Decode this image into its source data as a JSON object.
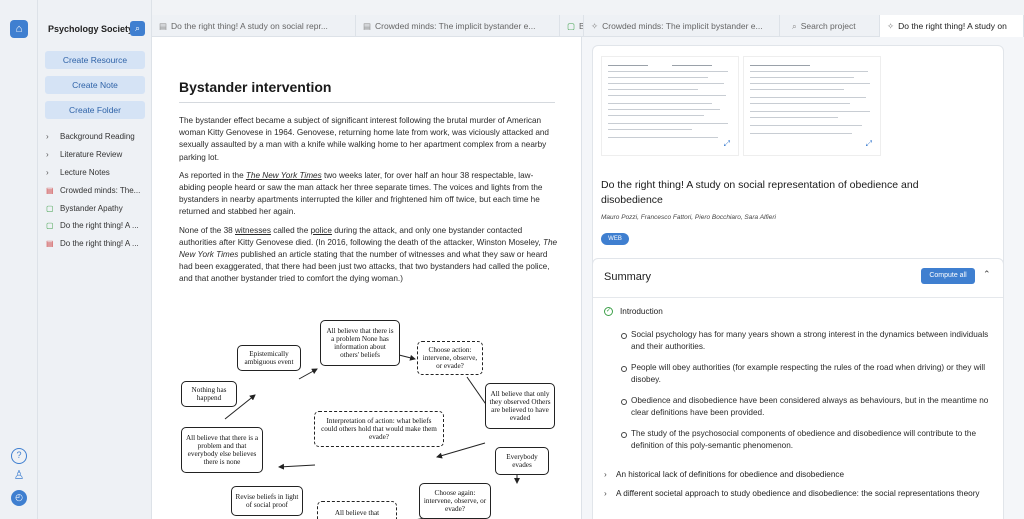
{
  "sidebar": {
    "title": "Psychology Society",
    "buttons": [
      "Create Resource",
      "Create Note",
      "Create Folder"
    ],
    "tree": [
      {
        "label": "Background Reading",
        "kind": "folder"
      },
      {
        "label": "Literature Review",
        "kind": "folder"
      },
      {
        "label": "Lecture Notes",
        "kind": "folder"
      },
      {
        "label": "Crowded minds: The...",
        "kind": "pdf"
      },
      {
        "label": "Bystander Apathy",
        "kind": "note"
      },
      {
        "label": "Do the right thing! A ...",
        "kind": "note"
      },
      {
        "label": "Do the right thing! A ...",
        "kind": "pdf"
      }
    ]
  },
  "tabs": [
    {
      "label": "Do the right thing! A study on social repr...",
      "icon": "pdf-icon"
    },
    {
      "label": "Crowded minds: The implicit bystander e...",
      "icon": "page-icon"
    },
    {
      "label": "B",
      "icon": "note-icon"
    },
    {
      "label": "Crowded minds: The implicit bystander e...",
      "icon": "sparkle-icon"
    },
    {
      "label": "Search project",
      "icon": "search-icon"
    },
    {
      "label": "Do the right thing! A study on",
      "icon": "sparkle-icon"
    }
  ],
  "document": {
    "title": "Bystander intervention",
    "p1": "The bystander effect became a subject of significant interest following the brutal murder of American woman Kitty Genovese in 1964. Genovese, returning home late from work, was viciously attacked and sexually assaulted by a man with a knife while walking home to her apartment complex from a nearby parking lot.",
    "p2_a": "As reported in the ",
    "p2_link": "The New York Times",
    "p2_b": " two weeks later, for over half an hour 38 respectable, law-abiding people heard or saw the man attack her three separate times. The voices and lights from the bystanders in nearby apartments interrupted the killer and frightened him off twice, but each time he returned and stabbed her again.",
    "p3_a": "None of the 38 ",
    "p3_link1": "witnesses",
    "p3_b": " called the ",
    "p3_link2": "police",
    "p3_c": " during the attack, and only one bystander contacted authorities after Kitty Genovese died. (In 2016, following the death of the attacker, Winston Moseley, ",
    "p3_ital": "The New York Times",
    "p3_d": " published an article stating that the number of witnesses and what they saw or heard had been exaggerated, that there had been just two attacks, that two bystanders had called the police, and that another bystander tried to comfort the dying woman.)",
    "diagram": {
      "n_believe_problem": "All believe that there is a problem None has information about others' beliefs",
      "n_ambiguous": "Epistemically ambiguous event",
      "n_choose": "Choose action: intervene, observe, or evade?",
      "n_nothing": "Nothing has happend",
      "n_observed": "All believe that only they observed Others are believed to have evaded",
      "n_interpret": "Interpretation of action: what beliefs could others hold that would make them evade?",
      "n_everybody_else": "All believe that there is a problem and that everybody else believes there is none",
      "n_evades": "Everybody evades",
      "n_revise": "Revise beliefs in light of social proof",
      "n_believe_partial": "All believe that",
      "n_choose_again": "Choose again: intervene, observe, or evade?"
    }
  },
  "card": {
    "title": "Do the right thing! A study on social representation of obedience and disobedience",
    "authors": "Mauro Pozzi, Francesco Fattori, Piero Bocchiaro, Sara Alfieri",
    "badge": "WEB"
  },
  "summary": {
    "heading": "Summary",
    "compute_label": "Compute all",
    "intro": "Introduction",
    "bullets": [
      "Social psychology has for many years shown a strong interest in the dynamics between individuals and their authorities.",
      "People will obey authorities (for example respecting the rules of the road when driving) or they will disobey.",
      "Obedience and disobedience have been considered always as behaviours, but in the meantime no clear definitions have been provided.",
      "The study of the psychosocial components of obedience and disobedience will contribute to the definition of this poly-semantic phenomenon."
    ],
    "sections": [
      "An historical lack of definitions for obedience and disobedience",
      "A different societal approach to study obedience and disobedience: the social representations theory"
    ]
  }
}
